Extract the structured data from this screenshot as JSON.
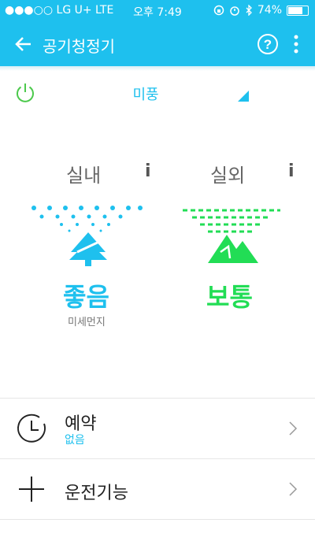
{
  "status_bar": {
    "carrier": "●●●○○ LG U+  LTE",
    "time": "오후 7:49",
    "battery": "74%",
    "battery_level": 0.74
  },
  "app_bar": {
    "title": "공기청정기"
  },
  "control": {
    "mode": "미풍"
  },
  "indoor": {
    "label": "실내",
    "info": "i",
    "quality": "좋음",
    "sublabel": "미세먼지",
    "color": "#1ec0ee"
  },
  "outdoor": {
    "label": "실외",
    "info": "i",
    "quality": "보통",
    "color": "#22dd55"
  },
  "menu": [
    {
      "label": "예약",
      "sublabel": "없음",
      "icon": "clock-icon"
    },
    {
      "label": "운전기능",
      "icon": "plus-icon"
    }
  ],
  "colors": {
    "accent": "#1ec0ee",
    "green": "#22dd55",
    "power": "#4cc94c"
  }
}
